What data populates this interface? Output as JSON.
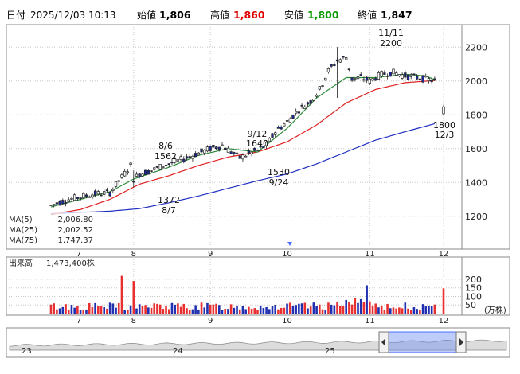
{
  "header": {
    "date_label": "日付",
    "datetime": "2025/12/03 10:13",
    "open_label": "始値",
    "open_value": "1,806",
    "high_label": "高値",
    "high_value": "1,860",
    "low_label": "安値",
    "low_value": "1,800",
    "close_label": "終値",
    "close_value": "1,847"
  },
  "colors": {
    "up": "#ffffff",
    "down": "#1a2a9c",
    "ma5": "#2e8b3a",
    "ma25": "#e02020",
    "ma75": "#2030c0",
    "vol_up": "#e83030",
    "vol_down": "#2030b0",
    "high_text": "#e00000",
    "low_text": "#0a9a00",
    "cursor": "#4a6cff"
  },
  "legend": [
    {
      "name": "MA(5)",
      "value": "2,006.80"
    },
    {
      "name": "MA(25)",
      "value": "2,002.52"
    },
    {
      "name": "MA(75)",
      "value": "1,747.37"
    }
  ],
  "volume_panel": {
    "title": "出来高",
    "latest": "1,473,400株",
    "unit": "(万株)"
  },
  "navigator": {
    "labels": [
      "23",
      "24",
      "25"
    ]
  },
  "chart_data": {
    "type": "candlestick",
    "ylim": [
      1050,
      2330
    ],
    "yticks": [
      1200,
      1400,
      1600,
      1800,
      2000,
      2200
    ],
    "x_day_range": [
      0,
      165
    ],
    "month_ticks": [
      {
        "day": 28,
        "label": "8"
      },
      {
        "day": 54,
        "label": "9"
      },
      {
        "day": 80,
        "label": "10"
      },
      {
        "day": 108,
        "label": "11"
      },
      {
        "day": 133,
        "label": "12"
      }
    ],
    "annotations": [
      {
        "day": 59,
        "price": 1640,
        "date": "9/12",
        "value": "1640",
        "pos": "above"
      },
      {
        "day": 98,
        "price": 2200,
        "date": "11/11",
        "value": "2200",
        "pos": "above"
      },
      {
        "day": 92,
        "price": 1530,
        "date": "9/24",
        "value": "1530",
        "pos": "below"
      },
      {
        "day": 127,
        "price": 1372,
        "date": "8/7",
        "value": "1372",
        "pos": "below"
      },
      {
        "day": 132,
        "price": 1800,
        "date": "12/3",
        "value": "1800",
        "pos": "below"
      },
      {
        "day": 28,
        "price": 1562,
        "date": "8/6",
        "value": "1562",
        "pos": "above"
      }
    ],
    "candle_anchors": [
      [
        0,
        1265
      ],
      [
        6,
        1300
      ],
      [
        14,
        1330
      ],
      [
        20,
        1340
      ],
      [
        24,
        1430
      ],
      [
        27,
        1500
      ],
      [
        28,
        1420
      ],
      [
        30,
        1450
      ],
      [
        34,
        1470
      ],
      [
        38,
        1500
      ],
      [
        42,
        1520
      ],
      [
        48,
        1560
      ],
      [
        54,
        1600
      ],
      [
        58,
        1620
      ],
      [
        61,
        1580
      ],
      [
        64,
        1545
      ],
      [
        67,
        1570
      ],
      [
        70,
        1590
      ],
      [
        73,
        1620
      ],
      [
        76,
        1700
      ],
      [
        80,
        1760
      ],
      [
        84,
        1830
      ],
      [
        88,
        1880
      ],
      [
        91,
        1950
      ],
      [
        94,
        2060
      ],
      [
        97,
        2120
      ],
      [
        100,
        2140
      ],
      [
        102,
        2010
      ],
      [
        105,
        2020
      ],
      [
        108,
        2000
      ],
      [
        112,
        2040
      ],
      [
        116,
        2050
      ],
      [
        120,
        2030
      ],
      [
        124,
        2020
      ],
      [
        127,
        2010
      ],
      [
        130,
        2000
      ]
    ],
    "last_candle": {
      "day": 133,
      "open": 1806,
      "high": 1860,
      "low": 1800,
      "close": 1847
    },
    "ma5_anchors": [
      [
        0,
        1255
      ],
      [
        10,
        1300
      ],
      [
        20,
        1345
      ],
      [
        28,
        1420
      ],
      [
        40,
        1490
      ],
      [
        50,
        1560
      ],
      [
        60,
        1600
      ],
      [
        70,
        1580
      ],
      [
        80,
        1720
      ],
      [
        90,
        1900
      ],
      [
        100,
        2020
      ],
      [
        110,
        2020
      ],
      [
        120,
        2040
      ],
      [
        127,
        2030
      ],
      [
        130,
        2006.8
      ]
    ],
    "ma25_anchors": [
      [
        0,
        1210
      ],
      [
        10,
        1240
      ],
      [
        20,
        1300
      ],
      [
        30,
        1390
      ],
      [
        40,
        1440
      ],
      [
        50,
        1500
      ],
      [
        60,
        1550
      ],
      [
        70,
        1580
      ],
      [
        80,
        1640
      ],
      [
        90,
        1740
      ],
      [
        100,
        1870
      ],
      [
        110,
        1950
      ],
      [
        120,
        1990
      ],
      [
        130,
        2002.52
      ]
    ],
    "ma75_anchors": [
      [
        0,
        1215
      ],
      [
        20,
        1230
      ],
      [
        30,
        1245
      ],
      [
        40,
        1280
      ],
      [
        50,
        1320
      ],
      [
        60,
        1365
      ],
      [
        70,
        1410
      ],
      [
        80,
        1450
      ],
      [
        90,
        1510
      ],
      [
        100,
        1580
      ],
      [
        110,
        1650
      ],
      [
        120,
        1700
      ],
      [
        130,
        1747.37
      ]
    ],
    "volume_ylim": [
      0,
      260
    ],
    "volume_ticks": [
      50,
      100,
      150,
      200
    ],
    "volume_spikes": [
      {
        "day": 24,
        "value": 220
      },
      {
        "day": 28,
        "value": 190
      },
      {
        "day": 107,
        "value": 165
      },
      {
        "day": 133,
        "value": 147
      }
    ],
    "volume_base": 38
  }
}
